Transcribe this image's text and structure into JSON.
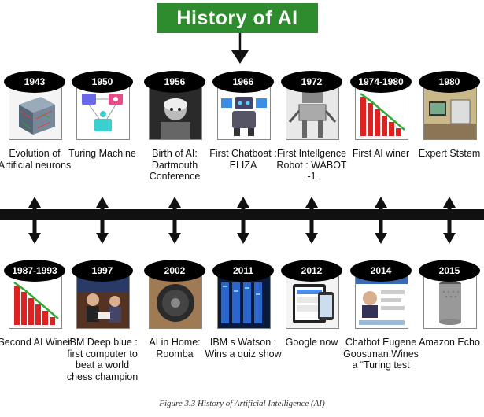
{
  "title": "History of AI",
  "caption": "Figure 3.3 History of Artificial Intelligence (AI)",
  "colors": {
    "title_bg": "#2e8b2e",
    "badge": "#000000",
    "axis": "#111111"
  },
  "top_events": [
    {
      "year": "1943",
      "label": "Evolution of Artificial neurons",
      "icon": "neuron-cube-image"
    },
    {
      "year": "1950",
      "label": "Turing Machine",
      "icon": "turing-test-diagram-image"
    },
    {
      "year": "1956",
      "label": "Birth of AI: Dartmouth Conference",
      "icon": "dartmouth-portrait-image"
    },
    {
      "year": "1966",
      "label": "First Chatboat : ELIZA",
      "icon": "eliza-robot-image"
    },
    {
      "year": "1972",
      "label": "First Intellgence Robot : WABOT -1",
      "icon": "wabot-robot-image"
    },
    {
      "year": "1974-1980",
      "label": "First AI winer",
      "icon": "declining-bar-chart-image"
    },
    {
      "year": "1980",
      "label": "Expert Ststem",
      "icon": "expert-system-office-image"
    }
  ],
  "bottom_events": [
    {
      "year": "1987-1993",
      "label": "Second AI Winer",
      "icon": "declining-bar-chart-image"
    },
    {
      "year": "1997",
      "label": "IBM Deep blue : first computer to beat a world chess champion",
      "icon": "chess-match-image"
    },
    {
      "year": "2002",
      "label": "AI in Home: Roomba",
      "icon": "roomba-image"
    },
    {
      "year": "2011",
      "label": "IBM s Watson : Wins a quiz show",
      "icon": "watson-server-image"
    },
    {
      "year": "2012",
      "label": "Google now",
      "icon": "google-now-tablet-image"
    },
    {
      "year": "2014",
      "label": "Chatbot Eugene Goostman:Wines a “Turing test",
      "icon": "eugene-chatbot-screen-image"
    },
    {
      "year": "2015",
      "label": "Amazon Echo",
      "icon": "amazon-echo-image"
    }
  ]
}
